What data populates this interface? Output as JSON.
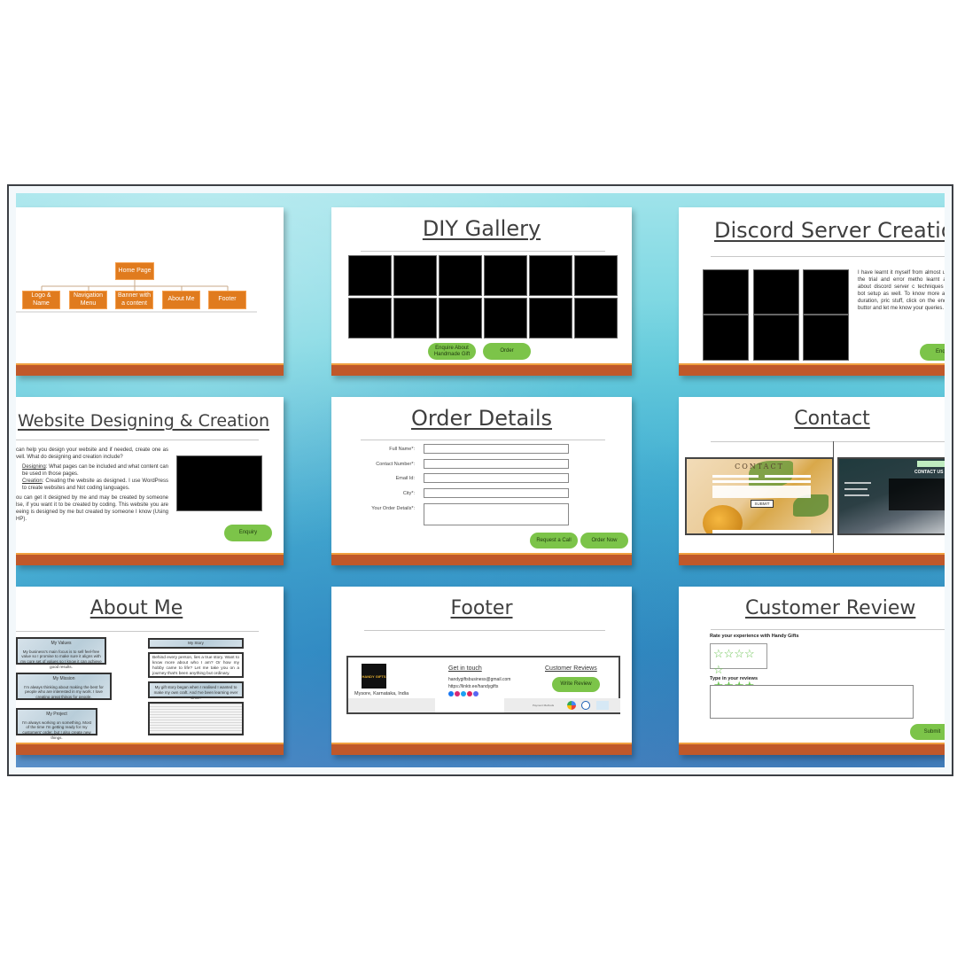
{
  "slides": {
    "sitemap": {
      "root": "Home Page",
      "children": [
        "Logo & Name",
        "Navigation Menu",
        "Banner with a content",
        "About Me",
        "Footer"
      ]
    },
    "gallery": {
      "title": "DIY Gallery",
      "image_count": 12,
      "buttons": [
        "Enquire About Handmade Gift",
        "Order"
      ]
    },
    "discord": {
      "title": "Discord Server Creation",
      "body": "I have learnt it myself from almost using the trial and error metho learnt a lot about discord server c techniques and bot setup as well. To know more about duration, pric stuff, click on the enquiry buttor and let me know your queries.",
      "button": "Enqu"
    },
    "website": {
      "title": "Website Designing & Creation",
      "intro": "can help you design your website and if needed, create one as vell. What do designing and creation include?",
      "designing_label": "Designing",
      "designing_text": ": What pages can be included and what content can be used in those pages.",
      "creation_label": "Creation",
      "creation_text": ": Creating the website as designed. I use WordPress to create websites and Not coding languages.",
      "outro": "ou can get it designed by me and may be created by someone lse, if you want it to be created by coding. This website you are eeing is designed by me but created by someone I know (Using HP).",
      "button": "Enquiry"
    },
    "order": {
      "title": "Order Details",
      "fields": [
        "Full Name*:",
        "Contact Number*:",
        "Email Id:",
        "City*:",
        "Your Order Details*:"
      ],
      "buttons": [
        "Request a Call",
        "Order Now"
      ]
    },
    "contact": {
      "title": "Contact",
      "left_heading": "CONTACT",
      "left_submit": "SUBMIT",
      "right_heading": "CONTACT US"
    },
    "about": {
      "title": "About Me",
      "left_boxes": [
        {
          "title": "My Values",
          "text": "My business's main focus is to sell feel-free value so I promise to make sure it aligns with my core set of values so I know it can achieve good results."
        },
        {
          "title": "My Mission",
          "text": "I'm always thinking about making the best for people who are interested in my work. I love creating great things for people."
        },
        {
          "title": "My Project",
          "text": "I'm always working on something. Most of the time I'm getting ready for my customers' order, but I also create new things."
        }
      ],
      "story_title": "My Story",
      "story_text": "Behind every person, lies a true story. Want to know more about who I am? Or how my hobby came to life? Let me take you on a journey that's been anything but ordinary.",
      "story_note": "My gift story began when I realised I wanted to make my own craft. And I've been learning ever since."
    },
    "footer": {
      "title": "Footer",
      "location": "Mysore, Karnataka, India",
      "get_in_touch": "Get in touch",
      "email": "handygiftsbusiness@gmail.com",
      "link": "https://linktr.ee/handygifts",
      "reviews_heading": "Customer Reviews",
      "write_review": "Write Review",
      "payment_label": "Payment Methods",
      "logo_text": "HANDY GIFTS"
    },
    "review": {
      "title": "Customer Review",
      "rate_label": "Rate your experience with Handy Gifts",
      "rating": 4,
      "rating_max": 5,
      "type_label": "Type in your reviews",
      "submit": "Submit"
    }
  }
}
